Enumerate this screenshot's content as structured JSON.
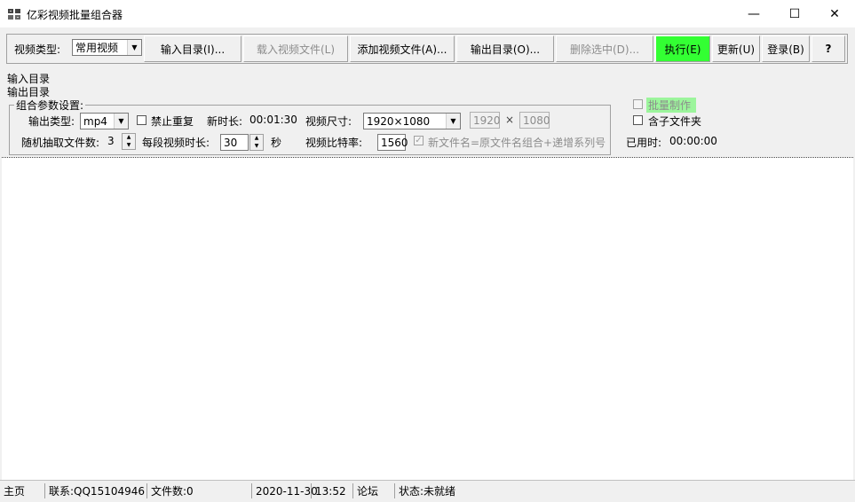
{
  "window": {
    "title": "亿彩视频批量组合器",
    "minimize": "—",
    "maximize": "☐",
    "close": "✕"
  },
  "toolbar": {
    "video_type_label": "视频类型:",
    "video_type_value": "常用视频",
    "input_dir": "输入目录(I)...",
    "load_video": "载入视频文件(L)",
    "add_video": "添加视频文件(A)...",
    "output_dir": "输出目录(O)...",
    "delete_selected": "删除选中(D)...",
    "execute": "执行(E)",
    "update": "更新(U)",
    "login": "登录(B)",
    "help": "?"
  },
  "info": {
    "input_dir_label": "输入目录",
    "output_dir_label": "输出目录"
  },
  "params": {
    "group_title": "组合参数设置:",
    "output_type_label": "输出类型:",
    "output_type_value": "mp4",
    "no_repeat_label": "禁止重复",
    "new_duration_label": "新时长:",
    "new_duration_value": "00:01:30",
    "video_size_label": "视频尺寸:",
    "video_size_value": "1920×1080",
    "width_value": "1920",
    "size_sep": "×",
    "height_value": "1080",
    "random_files_label": "随机抽取文件数:",
    "random_files_value": "3",
    "segment_duration_label": "每段视频时长:",
    "segment_duration_value": "30",
    "seconds_unit": "秒",
    "bitrate_label": "视频比特率:",
    "bitrate_value": "1560",
    "filename_rule_label": "新文件名=原文件名组合+递增系列号"
  },
  "side": {
    "batch_label": "批量制作",
    "subfolder_label": "含子文件夹",
    "elapsed_label": "已用时:",
    "elapsed_value": "00:00:00"
  },
  "status": {
    "home": "主页",
    "contact": "联系:QQ15104946",
    "file_count": "文件数:0",
    "date": "2020-11-30",
    "time": "13:52",
    "forum": "论坛",
    "state": "状态:未就绪"
  },
  "colors": {
    "execute_bg": "#33ff33",
    "batch_bg": "#9cf59c"
  }
}
